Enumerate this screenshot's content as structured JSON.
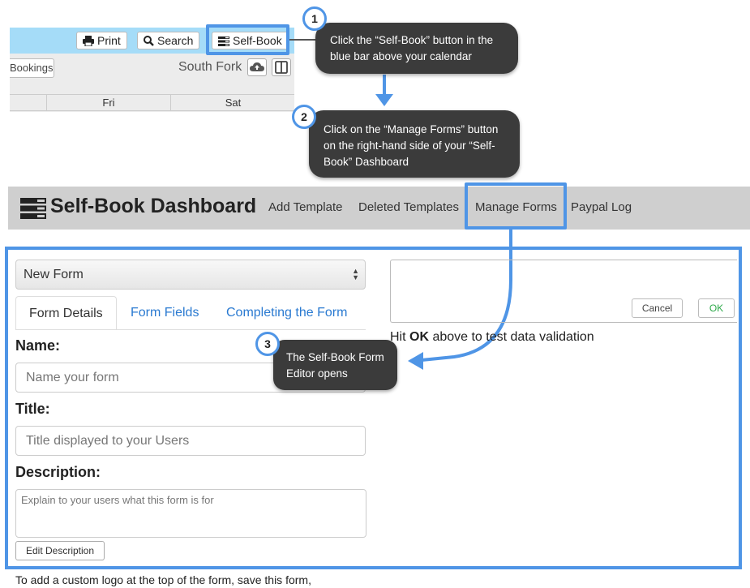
{
  "calendar": {
    "print_label": "Print",
    "search_label": "Search",
    "selfbook_label": "Self-Book",
    "bookings_label": "Bookings",
    "location": "South Fork",
    "days": [
      "Fri",
      "Sat"
    ]
  },
  "callouts": [
    {
      "num": "1",
      "text": "Click the “Self-Book” button in the blue bar above your calendar"
    },
    {
      "num": "2",
      "text": "Click on the “Manage Forms” button on the right-hand side of your “Self-Book” Dashboard"
    },
    {
      "num": "3",
      "text": "The Self-Book Form Editor opens"
    }
  ],
  "dashboard": {
    "title": "Self-Book Dashboard",
    "nav": [
      "Add Template",
      "Deleted Templates",
      "Manage Forms",
      "Paypal Log"
    ]
  },
  "form": {
    "select_value": "New Form",
    "tabs": [
      "Form Details",
      "Form Fields",
      "Completing the Form"
    ],
    "name_label": "Name:",
    "name_placeholder": "Name your form",
    "title_label": "Title:",
    "title_placeholder": "Title displayed to your Users",
    "description_label": "Description:",
    "description_placeholder": "Explain to your users what this form is for",
    "edit_description": "Edit Description",
    "footer": "To add a custom logo at the top of the form, save this form,"
  },
  "preview": {
    "cancel": "Cancel",
    "ok": "OK",
    "hint_pre": "Hit ",
    "hint_bold": "OK",
    "hint_post": " above to test data validation"
  },
  "colors": {
    "highlight": "#4f95e6",
    "calendar_bar": "#a5dcf8",
    "callout_bg": "#3b3b3b",
    "dashboard_bar": "#cfcfcf",
    "link": "#2a7ad1",
    "ok_green": "#2eaa4a"
  }
}
